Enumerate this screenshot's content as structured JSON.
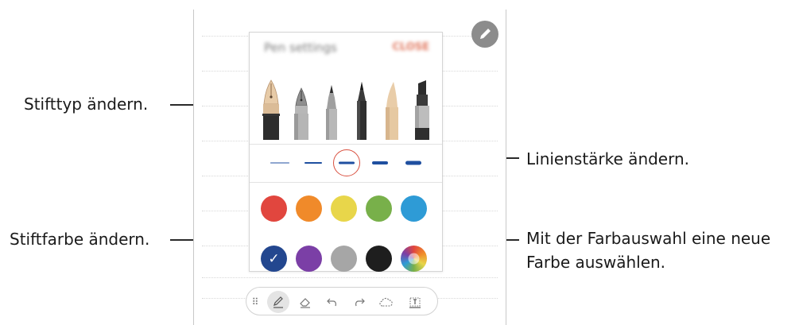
{
  "callouts": {
    "pen_type": "Stifttyp ändern.",
    "line_thickness": "Linienstärke ändern.",
    "pen_color": "Stiftfarbe ändern.",
    "color_picker_line1": "Mit der Farbauswahl eine neue",
    "color_picker_line2": "Farbe auswählen."
  },
  "panel": {
    "title": "Pen settings",
    "close_label": "CLOSE",
    "pen_types": [
      {
        "name": "fountain-pen-icon",
        "selected": true
      },
      {
        "name": "calligraphy-pen-icon",
        "selected": false
      },
      {
        "name": "pen-icon",
        "selected": false
      },
      {
        "name": "pencil-icon",
        "selected": false
      },
      {
        "name": "brush-icon",
        "selected": false
      },
      {
        "name": "marker-icon",
        "selected": false
      }
    ],
    "thickness_levels": [
      1,
      2,
      3,
      4,
      5
    ],
    "selected_thickness": 3,
    "colors": [
      {
        "hex": "#e1463e",
        "selected": false
      },
      {
        "hex": "#f08a2a",
        "selected": false
      },
      {
        "hex": "#e8d64a",
        "selected": false
      },
      {
        "hex": "#78b04a",
        "selected": false
      },
      {
        "hex": "#2e9bd6",
        "selected": false
      },
      {
        "hex": "#23478f",
        "selected": true
      },
      {
        "hex": "#7b3fa6",
        "selected": false
      },
      {
        "hex": "#a6a6a6",
        "selected": false
      },
      {
        "hex": "#1e1e1e",
        "selected": false
      },
      {
        "hex": "color-wheel",
        "selected": false
      }
    ],
    "check_glyph": "✓"
  },
  "toolbar": {
    "tools": [
      "drag-handle-icon",
      "pen-icon",
      "eraser-icon",
      "undo-icon",
      "redo-icon",
      "selection-icon",
      "text-icon"
    ],
    "active_tool": "pen-icon"
  },
  "colors": {
    "accent_red": "#d9503f",
    "thickness_blue": "#1f4fa0"
  }
}
